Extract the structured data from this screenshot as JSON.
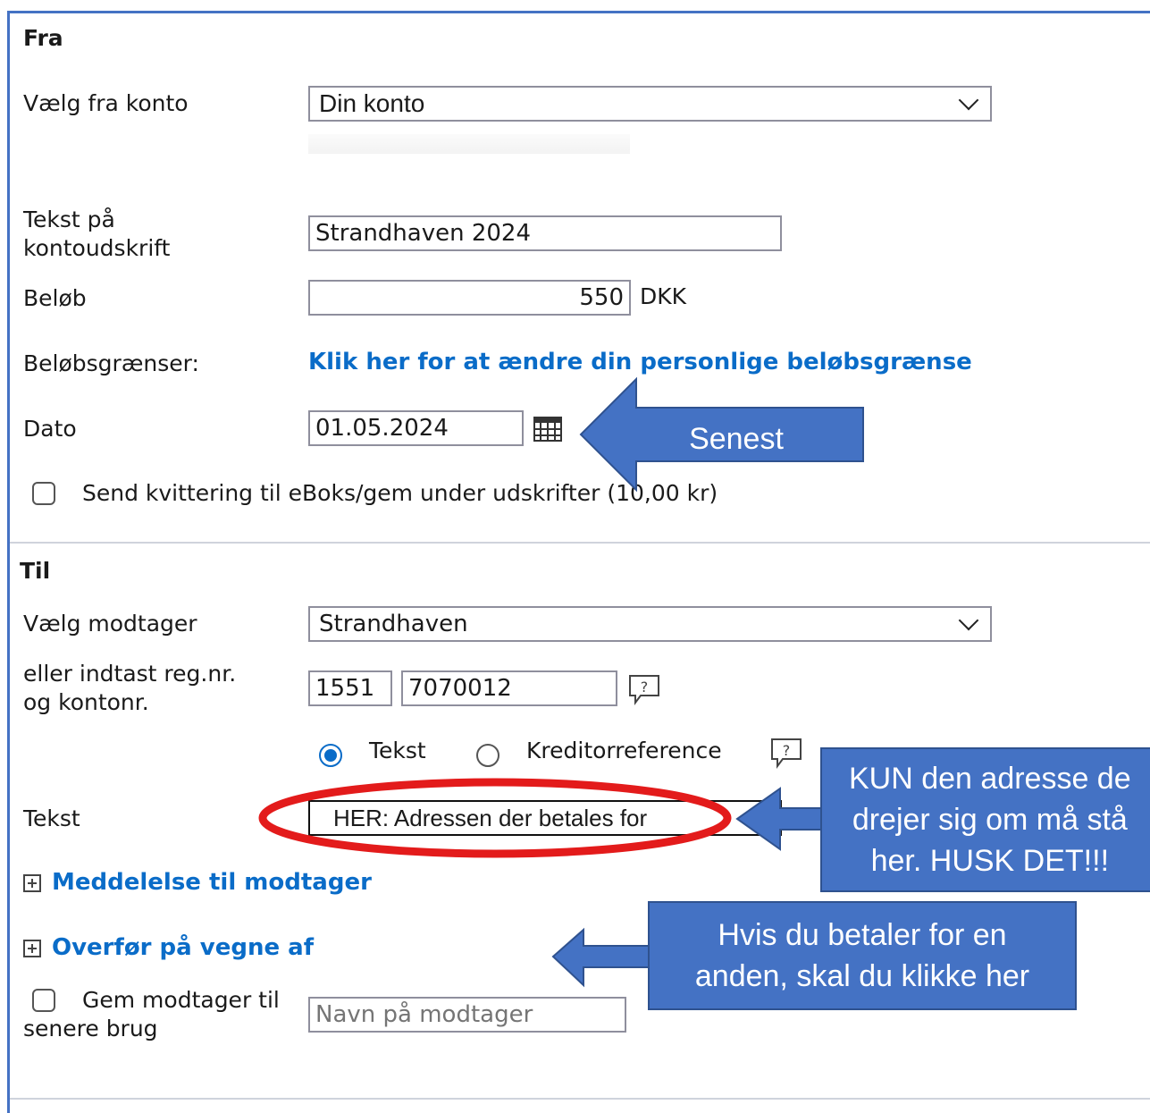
{
  "from": {
    "title": "Fra",
    "account_label": "Vælg fra konto",
    "account_value": "Din konto",
    "statement_text_label_1": "Tekst på",
    "statement_text_label_2": "kontoudskrift",
    "statement_text_value": "Strandhaven 2024",
    "amount_label": "Beløb",
    "amount_value": "550",
    "currency": "DKK",
    "limits_label": "Beløbsgrænser:",
    "limits_link": "Klik her for at ændre din personlige beløbsgrænse",
    "date_label": "Dato",
    "date_value": "01.05.2024",
    "receipt_label": "Send kvittering til eBoks/gem under udskrifter (10,00 kr)"
  },
  "to": {
    "title": "Til",
    "recipient_label": "Vælg modtager",
    "recipient_value": "Strandhaven",
    "regnr_label_1": "eller indtast reg.nr.",
    "regnr_label_2": "og kontonr.",
    "reg_value": "1551",
    "account_value": "7070012",
    "radio_text": "Tekst",
    "radio_creditor": "Kreditorreference",
    "text_label": "Tekst",
    "text_value": "HER: Adressen der betales for",
    "message_link": "Meddelelse til modtager",
    "behalf_link": "Overfør på vegne af",
    "save_label_1": "Gem modtager til",
    "save_label_2": "senere brug",
    "save_placeholder": "Navn på modtager"
  },
  "annotations": {
    "senest": "Senest",
    "kun_line1": "KUN den adresse de",
    "kun_line2": "drejer sig om må stå",
    "kun_line3": "her. HUSK DET!!!",
    "hvis_line1": "Hvis du betaler for en",
    "hvis_line2": "anden, skal du klikke her"
  },
  "colors": {
    "accent_link": "#0a6cc8",
    "callout_fill": "#4472c4",
    "highlight_ellipse": "#e31b1b"
  }
}
